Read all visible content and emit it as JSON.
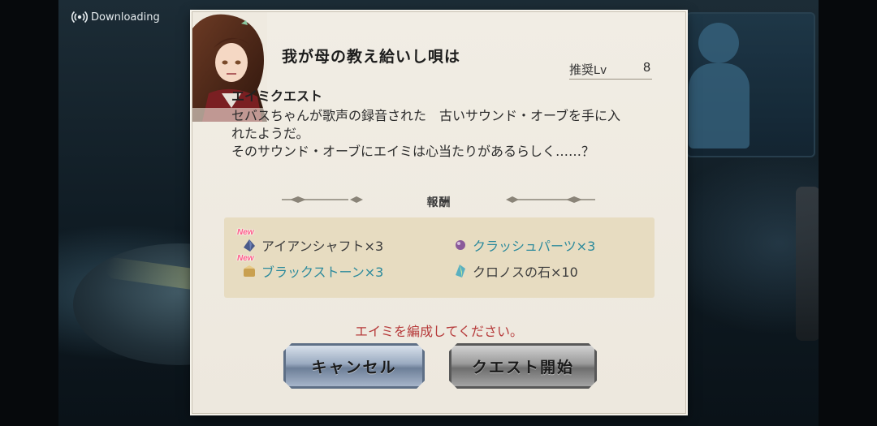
{
  "status": {
    "download_label": "Downloading"
  },
  "dialog": {
    "title": "我が母の教え給いし唄は",
    "level_label": "推奨Lv",
    "level_value": "8",
    "category": "エイミクエスト",
    "description": "セバスちゃんが歌声の録音された　古いサウンド・オーブを手に入\nれたようだ。\nそのサウンド・オーブにエイミは心当たりがあるらしく……？",
    "rewards_heading": "報酬",
    "rewards": [
      {
        "label": "アイアンシャフト×3",
        "new_badge": "New",
        "style": "plain",
        "icon": "iron-shaft-icon",
        "color": "#4a5a8a"
      },
      {
        "label": "クラッシュパーツ×3",
        "new_badge": "",
        "style": "link",
        "icon": "crush-parts-icon",
        "color": "#8a5a9a"
      },
      {
        "label": "ブラックストーン×3",
        "new_badge": "New",
        "style": "link",
        "icon": "blackstone-icon",
        "color": "#c9a050"
      },
      {
        "label": "クロノスの石×10",
        "new_badge": "",
        "style": "plain",
        "icon": "chronos-stone-icon",
        "color": "#5ab0c0"
      }
    ],
    "warning": "エイミを編成してください。",
    "cancel_label": "キャンセル",
    "start_label": "クエスト開始"
  },
  "colors": {
    "dialog_bg": "#efeae0",
    "reward_box_bg": "#e7dcc1",
    "link_text": "#2c8a9c",
    "warning_text": "#b63a3a"
  }
}
